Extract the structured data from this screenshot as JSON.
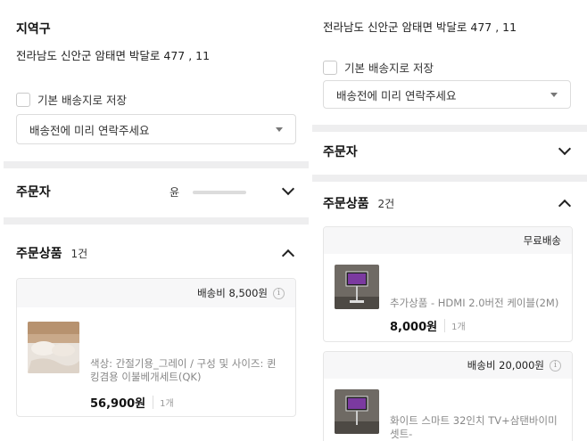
{
  "left": {
    "region_label": "지역구",
    "address": "전라남도 신안군 암태면 박달로 477 , 11",
    "default_address_label": "기본 배송지로 저장",
    "delivery_note": "배송전에 미리 연락주세요",
    "orderer": {
      "title": "주문자",
      "name": "윤"
    },
    "products": {
      "title": "주문상품",
      "count": "1건",
      "shipping_fee": "배송비 8,500원",
      "item": {
        "option": "색상: 간절기용_그레이 / 구성 및 사이즈: 퀸킹겸용 이불베개세트(QK)",
        "price": "56,900원",
        "quantity": "1개"
      }
    }
  },
  "right": {
    "address": "전라남도 신안군 암태면 박달로 477 , 11",
    "default_address_label": "기본 배송지로 저장",
    "delivery_note": "배송전에 미리 연락주세요",
    "orderer": {
      "title": "주문자"
    },
    "products": {
      "title": "주문상품",
      "count": "2건",
      "group1": {
        "shipping": "무료배송",
        "item": {
          "name": "추가상품 - HDMI 2.0버전 케이블(2M)",
          "price": "8,000원",
          "quantity": "1개"
        }
      },
      "group2": {
        "shipping_fee": "배송비 20,000원",
        "item": {
          "name": "화이트 스마트 32인치 TV+삼탠바이미 셋트-"
        }
      }
    }
  },
  "colors": {
    "divider": "#eeeeef",
    "card_header": "#f7f7f8",
    "muted_text": "#888888"
  }
}
